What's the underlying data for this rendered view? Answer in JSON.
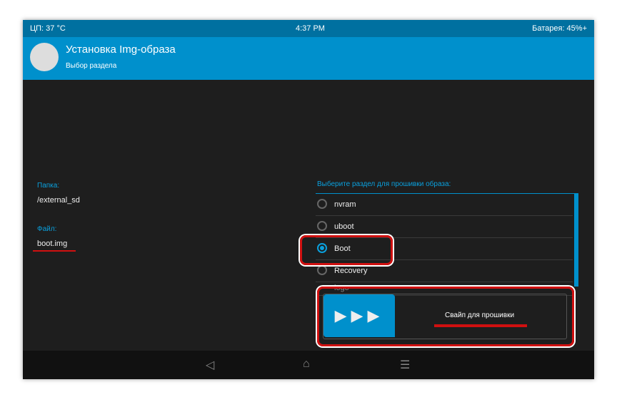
{
  "status": {
    "cpu": "ЦП: 37 °C",
    "time": "4:37 PM",
    "battery": "Батарея: 45%+"
  },
  "header": {
    "title": "Установка Img-образа",
    "subtitle": "Выбор раздела"
  },
  "left": {
    "folder_label": "Папка:",
    "folder_value": "/external_sd",
    "file_label": "Файл:",
    "file_value": "boot.img"
  },
  "partitions": {
    "prompt": "Выберите раздел для прошивки образа:",
    "items": [
      {
        "label": "nvram",
        "selected": false
      },
      {
        "label": "uboot",
        "selected": false
      },
      {
        "label": "Boot",
        "selected": true
      },
      {
        "label": "Recovery",
        "selected": false
      },
      {
        "label": "logo",
        "selected": false
      }
    ]
  },
  "swipe": {
    "label": "Свайп для прошивки",
    "handle": "▶▶▶"
  },
  "nav": {
    "back": "◁",
    "home": "⌂",
    "menu": "☰"
  }
}
